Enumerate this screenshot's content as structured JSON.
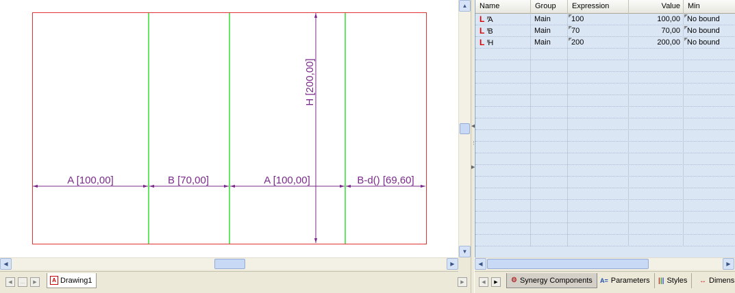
{
  "drawing": {
    "dimensions": {
      "a_left": "A [100,00]",
      "b": "B [70,00]",
      "a_mid": "A [100,00]",
      "bd": "B-d() [69,60]",
      "h": "H [200,00]"
    }
  },
  "document_tab": {
    "label": "Drawing1",
    "icon": "drawing-document-icon"
  },
  "grid": {
    "columns": [
      "Name",
      "Group",
      "Expression",
      "Value",
      "Min"
    ],
    "rows": [
      {
        "name": "A",
        "group": "Main",
        "expression": "100",
        "value": "100,00",
        "min": "No bound"
      },
      {
        "name": "B",
        "group": "Main",
        "expression": "70",
        "value": "70,00",
        "min": "No bound"
      },
      {
        "name": "H",
        "group": "Main",
        "expression": "200",
        "value": "200,00",
        "min": "No bound"
      }
    ],
    "lock_symbol": "L"
  },
  "panel_tabs": {
    "synergy": "Synergy Components",
    "parameters": "Parameters",
    "styles": "Styles",
    "dimensions": "Dimens"
  },
  "colors": {
    "frame": "#e03030",
    "divider": "#33dd33",
    "dimension": "#7a2a8a",
    "grid_bg": "#dbe6f4"
  }
}
